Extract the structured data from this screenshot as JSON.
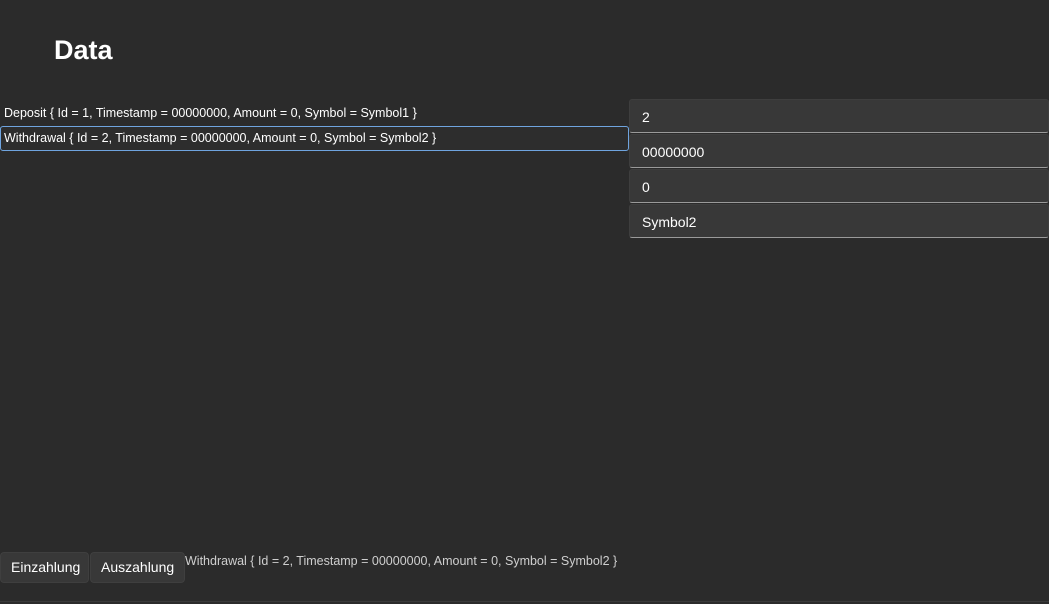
{
  "page": {
    "title": "Data"
  },
  "records": [
    {
      "text": "Deposit { Id = 1, Timestamp = 00000000, Amount = 0, Symbol = Symbol1 }",
      "selected": false
    },
    {
      "text": "Withdrawal { Id = 2, Timestamp = 00000000, Amount = 0, Symbol = Symbol2 }",
      "selected": true
    }
  ],
  "detail": {
    "id": "2",
    "timestamp": "00000000",
    "amount": "0",
    "symbol": "Symbol2"
  },
  "actions": {
    "deposit_label": "Einzahlung",
    "withdraw_label": "Auszahlung"
  },
  "status": {
    "text": "Withdrawal { Id = 2, Timestamp = 00000000, Amount = 0, Symbol = Symbol2 }"
  },
  "colors": {
    "background": "#2b2b2b",
    "selection_border": "#6fa4df",
    "field_background": "#383838"
  }
}
